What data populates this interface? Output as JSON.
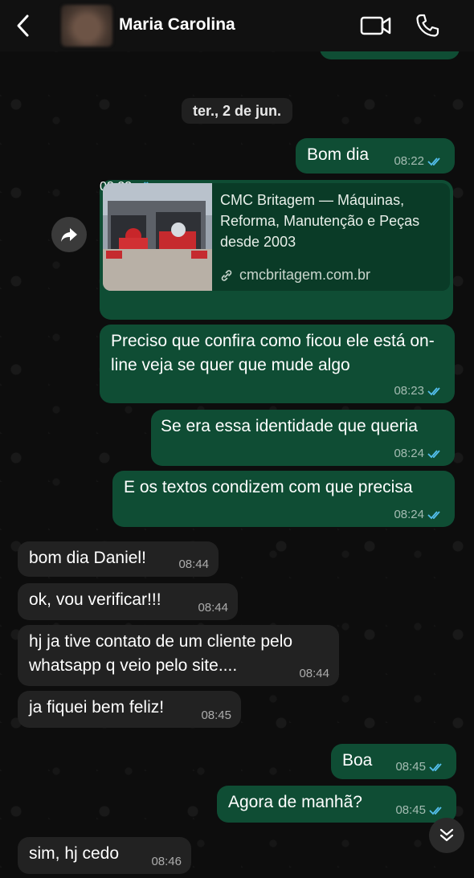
{
  "header": {
    "contact_name": "Maria Carolina",
    "icons": [
      "back-chevron-icon",
      "video-call-icon",
      "voice-call-icon"
    ]
  },
  "date_divider": "ter., 2 de jun.",
  "messages": [
    {
      "dir": "out",
      "text": "Bom dia",
      "time": "08:22"
    },
    {
      "dir": "out",
      "type": "link",
      "title": "CMC Britagem — Máquinas, Reforma, Manutenção e Peças desde 2003",
      "url": "cmcbritagem.com.br",
      "time": "08:22"
    },
    {
      "dir": "out",
      "text": "Preciso que confira como ficou ele está on-line veja se quer que mude algo",
      "time": "08:23"
    },
    {
      "dir": "out",
      "text": "Se era essa identidade que queria",
      "time": "08:24"
    },
    {
      "dir": "out",
      "text": "E os textos condizem com que precisa",
      "time": "08:24"
    },
    {
      "dir": "in",
      "text": "bom dia Daniel!",
      "time": "08:44"
    },
    {
      "dir": "in",
      "text": "ok, vou verificar!!!",
      "time": "08:44"
    },
    {
      "dir": "in",
      "text": "hj ja tive contato de um cliente pelo whatsapp q veio pelo site....",
      "time": "08:44"
    },
    {
      "dir": "in",
      "text": "ja fiquei bem feliz!",
      "time": "08:45"
    },
    {
      "dir": "out",
      "text": "Boa",
      "time": "08:45"
    },
    {
      "dir": "out",
      "text": "Agora de manhã?",
      "time": "08:45"
    },
    {
      "dir": "in",
      "text": "sim, hj cedo",
      "time": "08:46"
    }
  ],
  "colors": {
    "outgoing_bubble": "#0f4d34",
    "incoming_bubble": "#222222",
    "read_ticks": "#53bdeb"
  }
}
